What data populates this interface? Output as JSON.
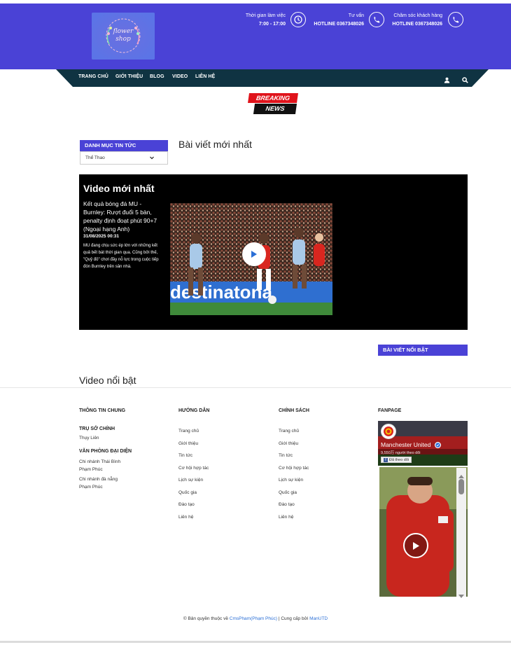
{
  "header": {
    "hours": {
      "label": "Thời gian làm việc",
      "value": "7:00 - 17:00"
    },
    "consult": {
      "label": "Tư vấn",
      "value": "HOTLINE 0367348026"
    },
    "care": {
      "label": "Chăm sóc khách hàng",
      "value": "HOTLINE 0367348026"
    },
    "logo_text": "flower shop"
  },
  "nav": {
    "items": [
      "TRANG CHỦ",
      "GIỚI THIỆU",
      "BLOG",
      "VIDEO",
      "LIÊN HỆ"
    ]
  },
  "breaking": {
    "line1": "BREAKING",
    "line2": "NEWS"
  },
  "category": {
    "title": "DANH MỤC TIN TỨC",
    "selected": "Thể Thao"
  },
  "latest_posts_title": "Bài viết mới nhất",
  "video_latest": {
    "title": "Video mới nhất",
    "headline": "Kết quả bóng đá MU - Burnley: Rượt đuổi 5 bàn, penalty định đoạt phút 90+7 (Ngoại hạng Anh)",
    "date": "31/08/2025 00:31",
    "desc": "MU đang chịu sức ép lớn với những kết quả bết bát thời gian qua. Cũng bởi thế, \"Quỷ đỏ\" chơi đầy nỗ lực trong cuộc tiếp đón Burnley trên sân nhà.",
    "thumb_ad": "destinatona"
  },
  "featured_title": "BÀI VIẾT NỔI BẬT",
  "featured_video_title": "Video nổi bật",
  "footer": {
    "general": {
      "title": "THÔNG TIN CHUNG",
      "hq_title": "TRỤ SỞ CHÍNH",
      "hq_value": "Thụy Liên",
      "office_title": "VĂN PHÒNG ĐẠI DIỆN",
      "branches": [
        {
          "name": "Chi nhánh Thái Bình",
          "person": "Phạm Phúc"
        },
        {
          "name": "Chi nhánh đà nẵng",
          "person": "Phạm Phúc"
        }
      ]
    },
    "guide": {
      "title": "HƯỚNG DẪN",
      "links": [
        "Trang chủ",
        "Giới thiệu",
        "Tin tức",
        "Cơ hội hợp tác",
        "Lịch sự kiện",
        "Quốc gia",
        "Đào tạo",
        "Liên hệ"
      ]
    },
    "policy": {
      "title": "CHÍNH SÁCH",
      "links": [
        "Trang chủ",
        "Giới thiệu",
        "Tin tức",
        "Cơ hội hợp tác",
        "Lịch sự kiện",
        "Quốc gia",
        "Đào tạo",
        "Liên hệ"
      ]
    },
    "fanpage": {
      "title": "FANPAGE",
      "page_name": "Manchester United",
      "followers": "9,550万 người theo dõi",
      "follow_btn": "Đã theo dõi"
    }
  },
  "copyright": {
    "prefix": "Bản quyền thuộc về",
    "owner": "CmsPham(Phạm Phúc)",
    "mid": "| Cung cấp bởi",
    "provider": "ManUTD"
  },
  "colors": {
    "brand": "#4a42d6",
    "nav": "#0f3342",
    "breaking": "#e0131b"
  }
}
